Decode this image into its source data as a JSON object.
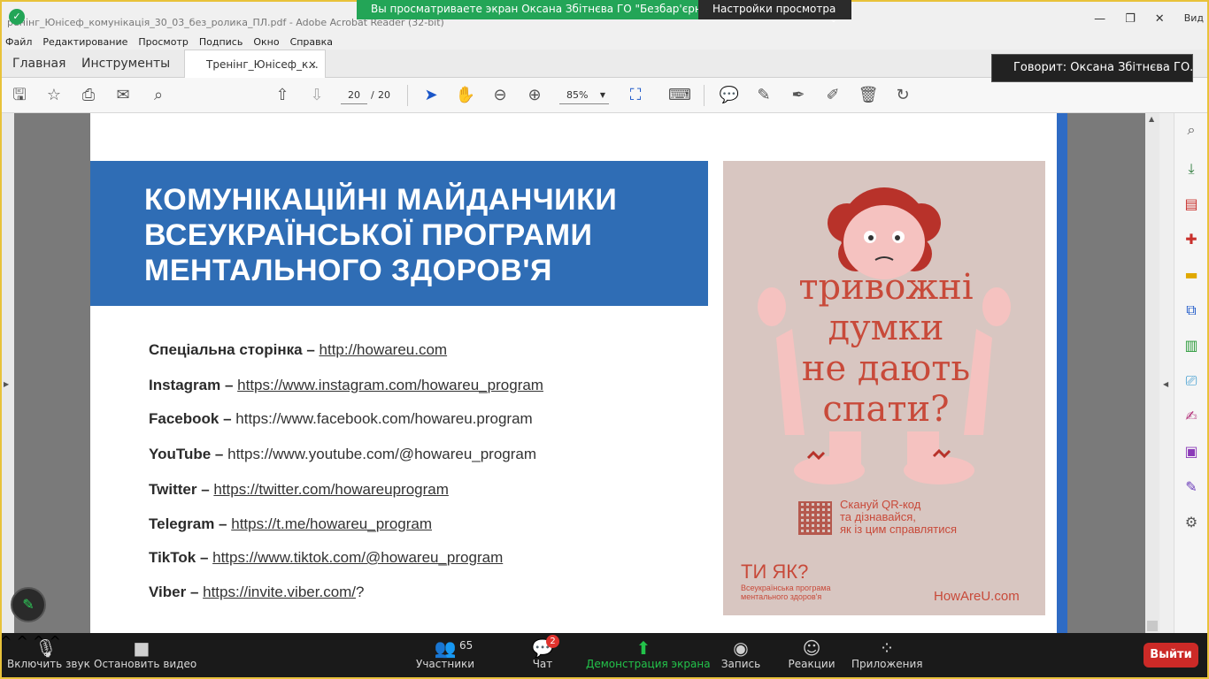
{
  "window": {
    "title": "ренінг_Юнісеф_комунікація_30_03_без_ролика_ПЛ.pdf - Adobe Acrobat Reader (32-bit)",
    "controls": [
      "—",
      "❐",
      "✕"
    ],
    "overflow": "Вид"
  },
  "zoom_banner": {
    "message": "Вы просматриваете экран Оксана Збітнєва ГО \"Безбар'єрн...",
    "options": "Настройки просмотра",
    "speaking": "Говорит: Оксана Збітнєва ГО..."
  },
  "menu": [
    "Файл",
    "Редактирование",
    "Просмотр",
    "Подпись",
    "Окно",
    "Справка"
  ],
  "tabs": {
    "home": "Главная",
    "tools": "Инструменты",
    "doc": "Тренінг_Юнісеф_к...",
    "close": "×"
  },
  "toolbar": {
    "page_current": "20",
    "page_sep": "/",
    "page_total": "20",
    "zoom": "85%"
  },
  "slide": {
    "title_lines": [
      "КОМУНІКАЦІЙНІ МАЙДАНЧИКИ",
      "ВСЕУКРАЇНСЬКОЇ ПРОГРАМИ",
      "МЕНТАЛЬНОГО ЗДОРОВ'Я"
    ],
    "links": [
      {
        "label": "Спеціальна сторінка",
        "sep": "  – ",
        "url": "http://howareu.com"
      },
      {
        "label": "Instagram",
        "sep": " – ",
        "url": "https://www.instagram.com/howareu_program"
      },
      {
        "label": "Facebook",
        "sep": " – ",
        "url": "https://www.facebook.com/howareu.program"
      },
      {
        "label": "YouTube",
        "sep": " – ",
        "url": "https://www.youtube.com/@howareu_program"
      },
      {
        "label": "Twitter",
        "sep": "  – ",
        "url": "https://twitter.com/howareuprogram"
      },
      {
        "label": "Telegram",
        "sep": " – ",
        "url": "https://t.me/howareu_program"
      },
      {
        "label": "TikTok",
        "sep": " – ",
        "url": "https://www.tiktok.com/@howareu_program"
      },
      {
        "label": "Viber",
        "sep": " – ",
        "url": "https://invite.viber.com/",
        "suffix": "?"
      }
    ],
    "poster": {
      "words": [
        "тривожні",
        "думки",
        "не дають",
        "спати?"
      ],
      "qr_text": [
        "Скануй QR-код",
        "та дізнавайся,",
        "як із цим справлятися"
      ],
      "brand": "ТИ ЯК?",
      "brand_sub": [
        "Всеукраїнська програма",
        "ментального здоров'я"
      ],
      "site": "HowAreU.com"
    }
  },
  "zoom_controls": {
    "audio": "Включить звук",
    "video": "Остановить видео",
    "participants": "Участники",
    "participants_count": "65",
    "chat": "Чат",
    "chat_badge": "2",
    "share": "Демонстрация экрана",
    "record": "Запись",
    "reactions": "Реакции",
    "apps": "Приложения",
    "exit": "Выйти"
  },
  "colors": {
    "header_band": "#2f6db5",
    "poster_bg": "#d8c6c1",
    "poster_text": "#c84a3a",
    "zoom_green": "#23a557",
    "exit_red": "#cc2a27"
  }
}
